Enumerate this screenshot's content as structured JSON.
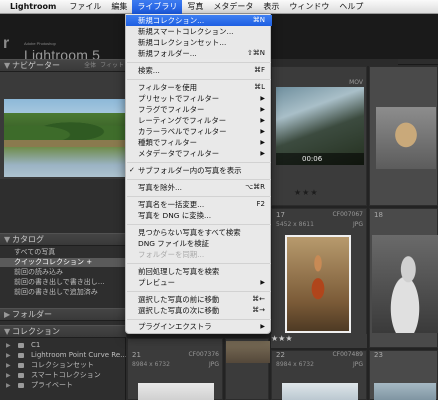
{
  "menubar": {
    "app": "Lightroom",
    "items": [
      "ファイル",
      "編集",
      "ライブラリ",
      "写真",
      "メタデータ",
      "表示",
      "ウィンドウ",
      "ヘルプ"
    ],
    "active_index": 2
  },
  "header": {
    "adobe": "Adobe Photoshop",
    "title": "Lightroom 5"
  },
  "left_panel": {
    "navigator": {
      "title": "ナビゲーター",
      "options": [
        "全体",
        "フィット"
      ]
    },
    "catalog": {
      "title": "カタログ",
      "items": [
        {
          "label": "すべての写真",
          "count": ""
        },
        {
          "label": "クイックコレクション +",
          "count": ""
        },
        {
          "label": "前回の読み込み",
          "count": ""
        },
        {
          "label": "前回の書き出しで書き出し…",
          "count": ""
        },
        {
          "label": "前回の書き出しで追加済み",
          "count": ""
        }
      ]
    },
    "folders": {
      "title": "フォルダー"
    },
    "collections": {
      "title": "コレクション",
      "items": [
        "C1",
        "Lightroom Point Curve Re…",
        "コレクションセット",
        "スマートコレクション",
        "プライベート"
      ]
    }
  },
  "grid": {
    "cells": [
      {
        "idx": "",
        "dims": "",
        "file": "",
        "ext": "MOV",
        "duration": "00:06",
        "stars": "★★★"
      },
      {
        "idx": "",
        "dims": "",
        "file": "",
        "ext": "",
        "duration": "",
        "stars": ""
      },
      {
        "idx": "17",
        "dims": "5452 x 8611",
        "file": "CF007067",
        "ext": "JPG",
        "duration": "",
        "stars": "★★★"
      },
      {
        "idx": "18",
        "dims": "",
        "file": "",
        "ext": "",
        "duration": "",
        "stars": ""
      },
      {
        "idx": "",
        "dims": "",
        "file": "",
        "ext": "",
        "duration": "",
        "stars": "★★★"
      },
      {
        "idx": "21",
        "dims": "8984 x 6732",
        "file": "CF007376",
        "ext": "JPG",
        "duration": "",
        "stars": ""
      },
      {
        "idx": "22",
        "dims": "8984 x 6732",
        "file": "CF007489",
        "ext": "JPG",
        "duration": "",
        "stars": ""
      },
      {
        "idx": "23",
        "dims": "",
        "file": "",
        "ext": "",
        "duration": "",
        "stars": ""
      }
    ]
  },
  "library_menu": {
    "items": [
      {
        "label": "新規コレクション...",
        "shortcut": "⌘N",
        "highlighted": true
      },
      {
        "label": "新規スマートコレクション...",
        "shortcut": ""
      },
      {
        "label": "新規コレクションセット...",
        "shortcut": ""
      },
      {
        "label": "新規フォルダー...",
        "shortcut": "⇧⌘N"
      },
      {
        "label": "検索...",
        "shortcut": "⌘F"
      },
      {
        "label": "フィルターを使用",
        "shortcut": "⌘L"
      },
      {
        "label": "プリセットでフィルター",
        "submenu": true
      },
      {
        "label": "フラグでフィルター",
        "submenu": true
      },
      {
        "label": "レーティングでフィルター",
        "submenu": true
      },
      {
        "label": "カラーラベルでフィルター",
        "submenu": true
      },
      {
        "label": "種類でフィルター",
        "submenu": true
      },
      {
        "label": "メタデータでフィルター",
        "submenu": true
      },
      {
        "label": "サブフォルダー内の写真を表示",
        "checked": true
      },
      {
        "label": "写真を除外...",
        "shortcut": "⌥⌘R"
      },
      {
        "label": "写真名を一括変更...",
        "shortcut": "F2"
      },
      {
        "label": "写真を DNG に変換...",
        "shortcut": ""
      },
      {
        "label": "見つからない写真をすべて検索",
        "shortcut": ""
      },
      {
        "label": "DNG ファイルを検証",
        "shortcut": ""
      },
      {
        "label": "フォルダーを同期...",
        "disabled": true
      },
      {
        "label": "前回処理した写真を検索",
        "shortcut": ""
      },
      {
        "label": "プレビュー",
        "submenu": true
      },
      {
        "label": "選択した写真の前に移動",
        "shortcut": "⌘←"
      },
      {
        "label": "選択した写真の次に移動",
        "shortcut": "⌘→"
      },
      {
        "label": "プラグインエクストラ",
        "submenu": true
      }
    ]
  }
}
